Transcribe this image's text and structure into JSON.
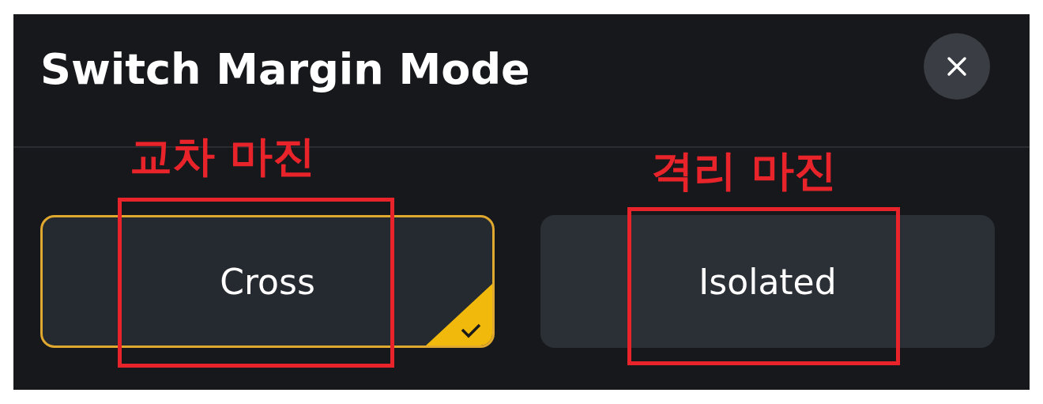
{
  "dialog": {
    "title": "Switch Margin Mode"
  },
  "options": [
    {
      "label": "Cross",
      "selected": true
    },
    {
      "label": "Isolated",
      "selected": false
    }
  ],
  "annotations": [
    {
      "label": "교차 마진"
    },
    {
      "label": "격리 마진"
    }
  ]
}
